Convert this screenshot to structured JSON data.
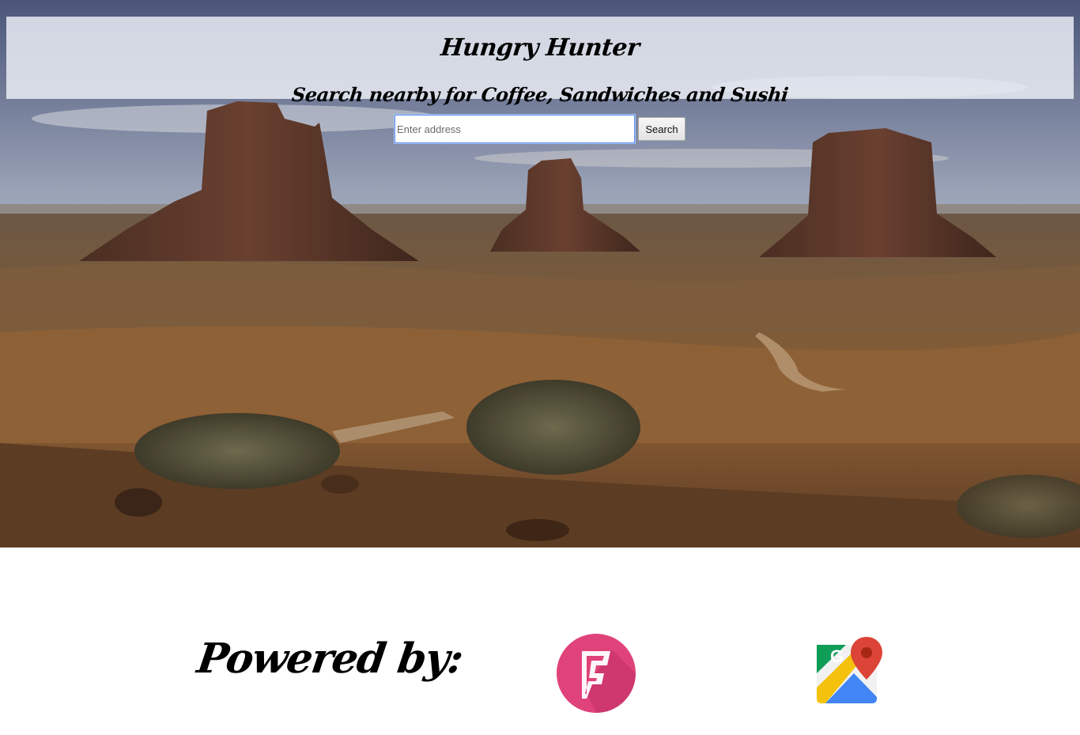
{
  "header": {
    "title": "Hungry Hunter",
    "subtitle": "Search nearby for Coffee, Sandwiches and Sushi"
  },
  "search": {
    "placeholder": "Enter address",
    "value": "",
    "button_label": "Search"
  },
  "footer": {
    "powered_by_label": "Powered by:",
    "logos": [
      {
        "name": "foursquare-logo",
        "icon": "foursquare-icon",
        "color": "#e0427a"
      },
      {
        "name": "google-maps-logo",
        "icon": "google-maps-icon",
        "letter": "G"
      }
    ]
  },
  "colors": {
    "header_band": "#ebeef5",
    "input_focus_border": "#5b8ff0",
    "foursquare_pink": "#e0427a",
    "maps_red": "#db4437",
    "maps_green": "#0f9d58",
    "maps_yellow": "#f4c20d",
    "maps_blue": "#4285f4"
  }
}
